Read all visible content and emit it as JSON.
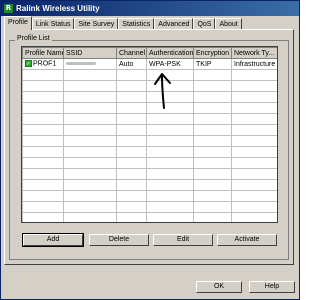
{
  "window": {
    "title": "Ralink Wireless Utility",
    "icon_letter": "R"
  },
  "tabs": [
    {
      "label": "Profile"
    },
    {
      "label": "Link Status"
    },
    {
      "label": "Site Survey"
    },
    {
      "label": "Statistics"
    },
    {
      "label": "Advanced"
    },
    {
      "label": "QoS"
    },
    {
      "label": "About"
    }
  ],
  "active_tab": "Profile",
  "profile_list": {
    "group_label": "Profile List",
    "columns": [
      "Profile Name",
      "SSID",
      "Channel",
      "Authentication",
      "Encryption",
      "Network Ty..."
    ],
    "rows": [
      {
        "profile_name": "PROF1",
        "ssid": "",
        "channel": "Auto",
        "authentication": "WPA-PSK",
        "encryption": "TKIP",
        "network_type": "Infrastructure",
        "status_icon": "connected-check-icon"
      }
    ]
  },
  "buttons": {
    "add": "Add",
    "delete": "Delete",
    "edit": "Edit",
    "activate": "Activate"
  },
  "footer": {
    "ok": "OK",
    "help": "Help"
  },
  "colors": {
    "title_bar": "#0a246a",
    "dialog_face": "#d4d0c8",
    "status_green": "#36b336"
  }
}
